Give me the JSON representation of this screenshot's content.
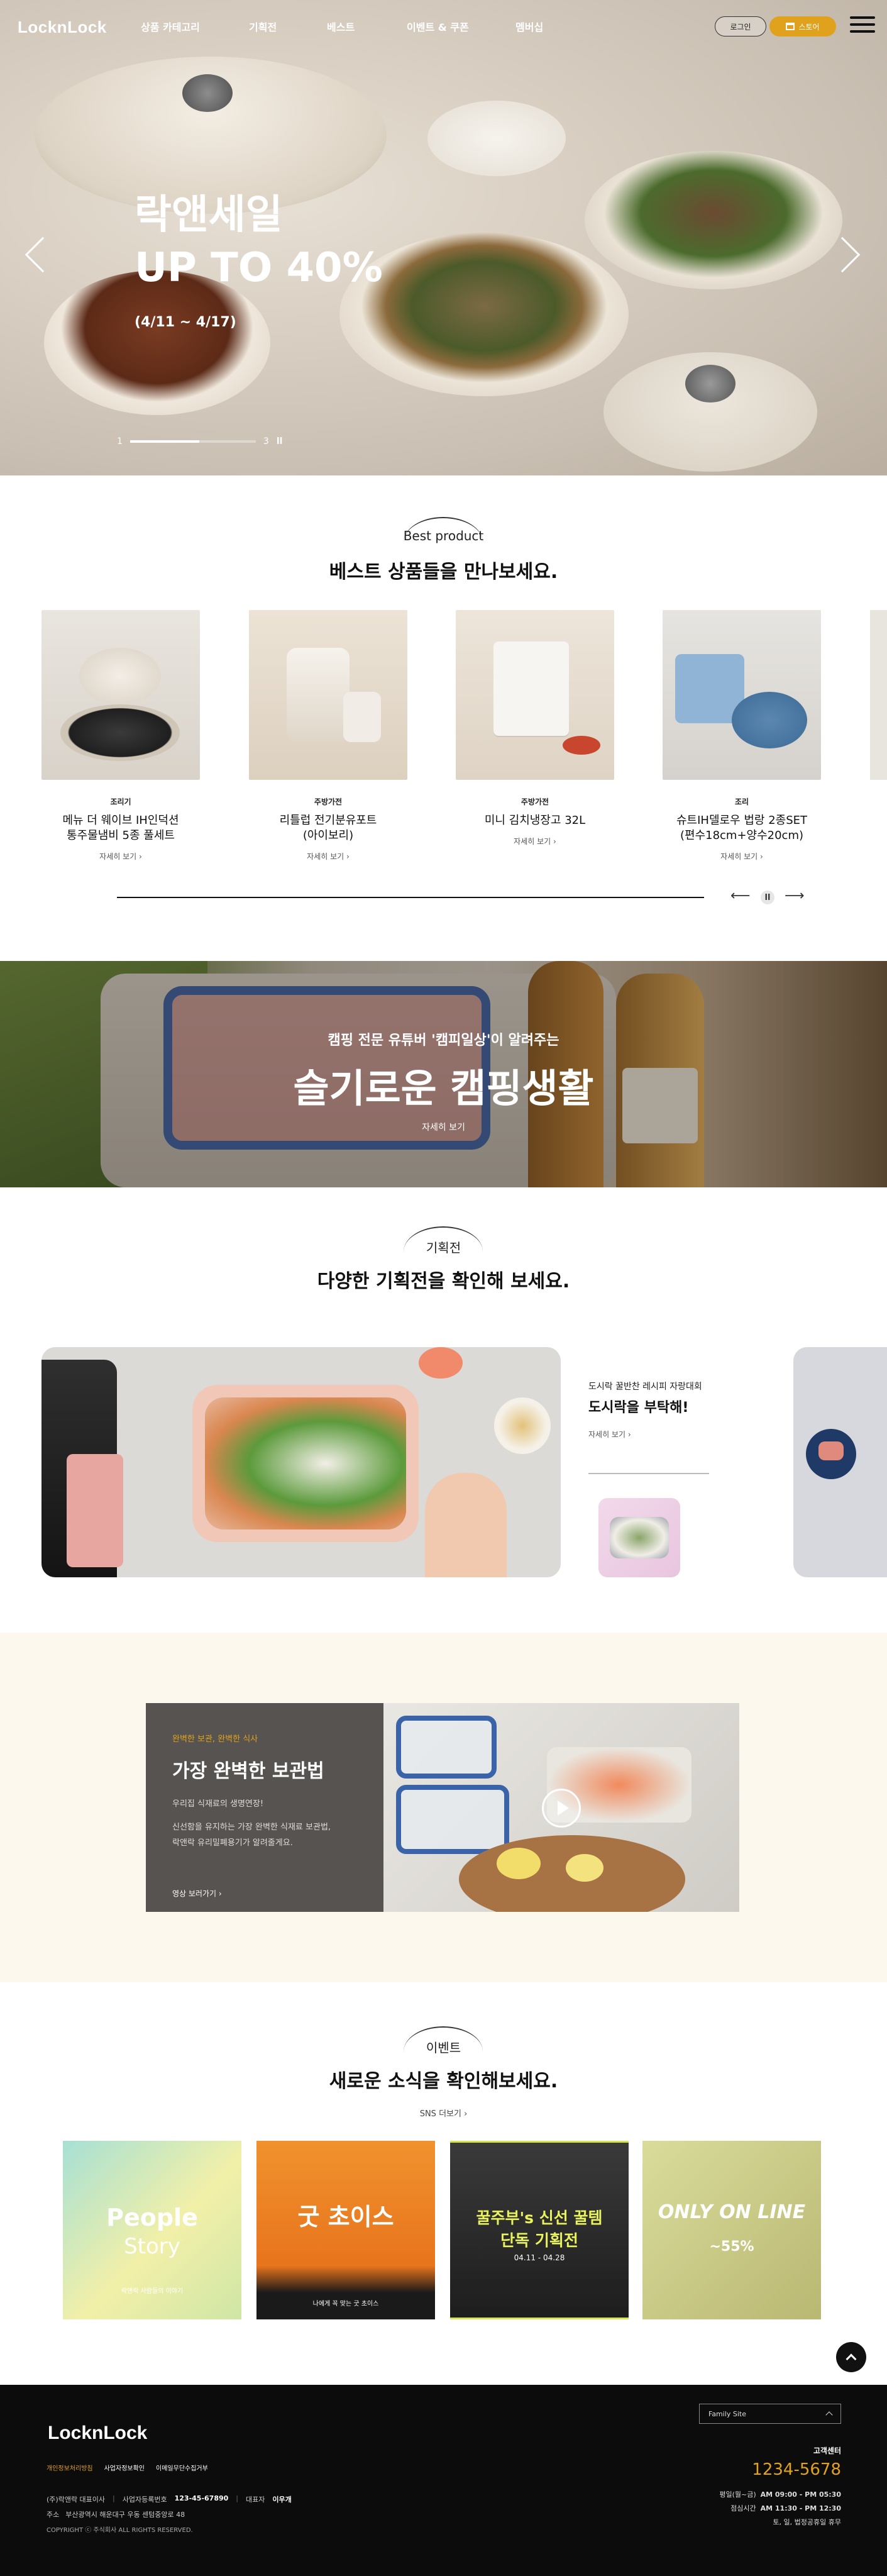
{
  "header": {
    "logo": "LocknLock",
    "nav": [
      "상품 카테고리",
      "기획전",
      "베스트",
      "이벤트 & 쿠폰",
      "멤버십"
    ],
    "login_label": "로그인",
    "store_label": "스토어"
  },
  "hero": {
    "title_line1": "락앤세일",
    "title_line2": "UP TO 40%",
    "subtitle": "(4/11 ~ 4/17)",
    "page_current": "1",
    "page_total": "3",
    "progress": 0.55
  },
  "best": {
    "tag": "Best product",
    "title": "베스트 상품들을 만나보세요.",
    "products": [
      {
        "category": "조리기",
        "name_line1": "메뉴 더 웨이브 IH인덕션",
        "name_line2": "통주물냄비 5종 풀세트",
        "more": "자세히 보기"
      },
      {
        "category": "주방가전",
        "name_line1": "리틀럽 전기분유포트",
        "name_line2": "(아이보리)",
        "more": "자세히 보기"
      },
      {
        "category": "주방가전",
        "name_line1": "미니 김치냉장고 32L",
        "name_line2": "",
        "more": "자세히 보기"
      },
      {
        "category": "조리",
        "name_line1": "슈트IH델로우 법랑 2종SET",
        "name_line2": "(편수18cm+양수20cm)",
        "more": "자세히 보기"
      }
    ]
  },
  "camping": {
    "subtitle": "캠핑 전문 유튜버 '캠피일상'이 알려주는",
    "title": "슬기로운 캠핑생활",
    "more": "자세히 보기"
  },
  "exhibition": {
    "tag": "기획전",
    "title": "다양한 기획전을 확인해 보세요.",
    "card_sub": "도시락 꿀반찬 레시피 자랑대회",
    "card_title": "도시락을 부탁해!",
    "card_more": "자세히 보기"
  },
  "storage": {
    "eyebrow": "완벽한 보관, 완벽한 식사",
    "title": "가장 완벽한 보관법",
    "desc1": "우리집 식재료의 생명연장!",
    "desc2": "신선함을 유지하는 가장 완벽한 식재료 보관법,",
    "desc3": "락앤락 유리밀폐용기가 알려줄게요.",
    "video_link": "영상 보러가기"
  },
  "events": {
    "tag": "이벤트",
    "title": "새로운 소식을 확인해보세요.",
    "sns": "SNS 더보기",
    "cards": [
      {
        "title_a": "People",
        "title_b": "Story",
        "caption": "락앤락 사람들의 이야기"
      },
      {
        "title_a": "굿 초이스",
        "title_b": "",
        "caption": "나에게 꼭 맞는 굿 초이스"
      },
      {
        "title_a": "꿀주부's 신선 꿀템",
        "title_b": "단독 기획전",
        "caption": "04.11 - 04.28"
      },
      {
        "title_a": "ONLY ON LINE",
        "title_b": "~55%",
        "caption": ""
      }
    ]
  },
  "footer": {
    "logo": "LocknLock",
    "links": [
      "개인정보처리방침",
      "사업자정보확인",
      "이메일무단수집거부"
    ],
    "company": "(주)락앤락 대표이사",
    "biz_no_label": "사업자등록번호",
    "biz_no": "123-45-67890",
    "rep_label": "대표자",
    "rep": "이우개",
    "address_label": "주소",
    "address": "부산광역시 해운대구 우동 센텀중앙로 48",
    "copyright": "COPYRIGHT ⓒ 주식회사 ALL RIGHTS RESERVED.",
    "family_site": "Family Site",
    "cs_label": "고객센터",
    "phone": "1234-5678",
    "hours_weekday_label": "평일(월~금)",
    "hours_weekday": "AM 09:00 - PM 05:30",
    "hours_lunch_label": "점심시간",
    "hours_lunch": "AM 11:30 - PM 12:30",
    "hours_note": "토, 일, 법정공휴일 휴무"
  },
  "colors": {
    "accent": "#e0a21c",
    "dark": "#0c0c0c",
    "cream": "#fdf8ee",
    "storage_panel": "#575350"
  }
}
